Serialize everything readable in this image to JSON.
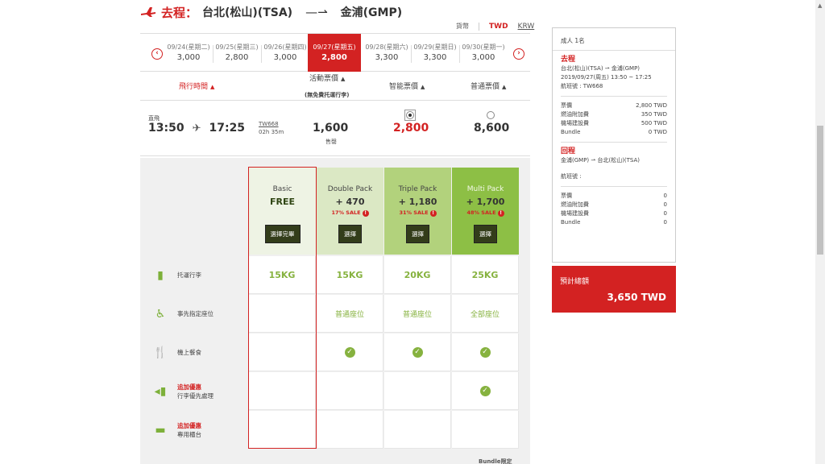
{
  "header": {
    "label": "去程：",
    "from": "台北(松山)(TSA)",
    "arrow": "—⇀",
    "to": "金浦(GMP)"
  },
  "currency": {
    "label": "貨幣",
    "selected": "TWD",
    "other": "KRW"
  },
  "dates": [
    {
      "date": "09/24(星期二)",
      "price": "3,000"
    },
    {
      "date": "09/25(星期三)",
      "price": "2,800"
    },
    {
      "date": "09/26(星期四)",
      "price": "3,000"
    },
    {
      "date": "09/27(星期五)",
      "price": "2,800",
      "selected": true
    },
    {
      "date": "09/28(星期六)",
      "price": "3,300"
    },
    {
      "date": "09/29(星期日)",
      "price": "3,300"
    },
    {
      "date": "09/30(星期一)",
      "price": "3,000"
    }
  ],
  "columns": {
    "flight_time": "飛行時間",
    "promo": "活動票價",
    "promo_sub": "(無免費托運行李)",
    "smart": "智能票價",
    "normal": "普通票價"
  },
  "flight": {
    "type": "直飛",
    "depart": "13:50",
    "arrive": "17:25",
    "number": "TW668",
    "duration": "02h 35m",
    "promo_fare": "1,600",
    "promo_status": "售罄",
    "smart_fare": "2,800",
    "normal_fare": "8,600"
  },
  "packages": [
    {
      "name": "Basic",
      "price": "FREE",
      "sale": "",
      "button": "選擇完畢"
    },
    {
      "name": "Double Pack",
      "price": "+ 470",
      "sale": "17% SALE",
      "button": "選擇"
    },
    {
      "name": "Triple Pack",
      "price": "+ 1,180",
      "sale": "31% SALE",
      "button": "選擇"
    },
    {
      "name": "Multi Pack",
      "price": "+ 1,700",
      "sale": "48% SALE",
      "button": "選擇"
    }
  ],
  "features": [
    {
      "promo": "",
      "label": "托運行李",
      "values": [
        "15KG",
        "15KG",
        "20KG",
        "25KG"
      ]
    },
    {
      "promo": "",
      "label": "事先指定座位",
      "values": [
        "",
        "普通座位",
        "普通座位",
        "全部座位"
      ]
    },
    {
      "promo": "",
      "label": "機上餐食",
      "values": [
        "",
        "check",
        "check",
        "check"
      ]
    },
    {
      "promo": "追加優惠",
      "label": "行李優先處理",
      "values": [
        "",
        "",
        "",
        "check"
      ]
    },
    {
      "promo": "追加優惠",
      "label": "專用櫃台",
      "values": [
        "",
        "",
        "",
        ""
      ]
    }
  ],
  "bundle_note": "Bundle限定",
  "summary": {
    "passengers": "成人 1名",
    "outbound": {
      "title": "去程",
      "route": "台北(松山)(TSA) ⇀ 金浦(GMP)",
      "datetime": "2019/09/27(周五) 13:50 ~ 17:25",
      "flight": "航班號 : TW668",
      "rows": [
        {
          "label": "票價",
          "value": "2,800 TWD"
        },
        {
          "label": "燃油附加費",
          "value": "350 TWD"
        },
        {
          "label": "機場建設費",
          "value": "500 TWD"
        },
        {
          "label": "Bundle",
          "value": "0 TWD"
        }
      ]
    },
    "return": {
      "title": "回程",
      "route": "金浦(GMP) ⇀ 台北(松山)(TSA)",
      "flight": "航班號 :",
      "rows": [
        {
          "label": "票價",
          "value": "0"
        },
        {
          "label": "燃油附加費",
          "value": "0"
        },
        {
          "label": "機場建設費",
          "value": "0"
        },
        {
          "label": "Bundle",
          "value": "0"
        }
      ]
    },
    "total_label": "預計總額",
    "total_value": "3,650 TWD"
  },
  "colors": {
    "accent": "#d32222",
    "green": "#86b23f"
  }
}
